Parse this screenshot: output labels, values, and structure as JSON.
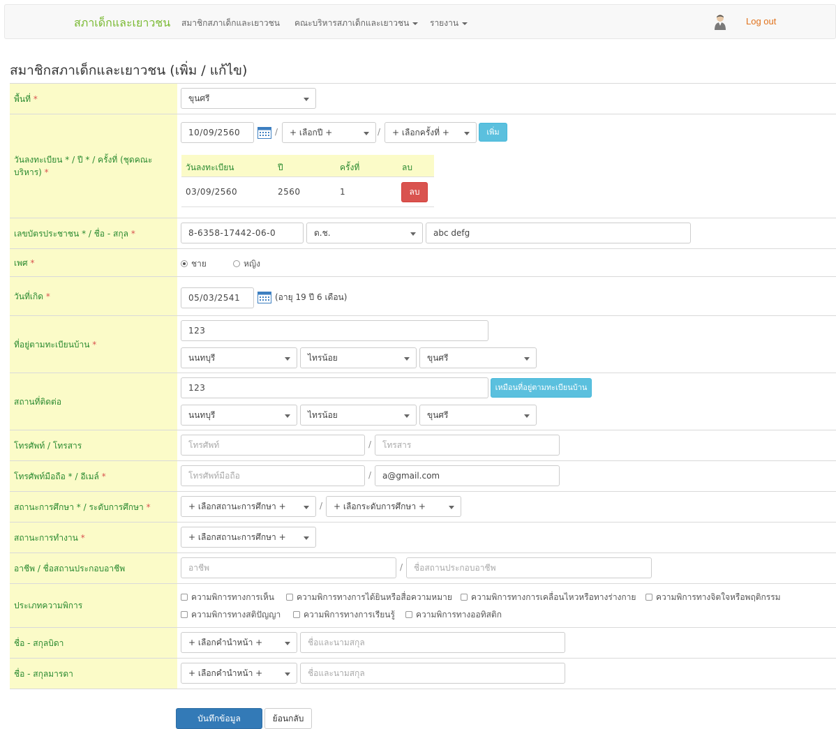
{
  "nav": {
    "brand": "สภาเด็กและเยาวชน",
    "members": "สมาชิกสภาเด็กและเยาวชน",
    "committee": "คณะบริหารสภาเด็กและเยาวชน",
    "report": "รายงาน",
    "logout": "Log out"
  },
  "page_title": "สมาชิกสภาเด็กและเยาวชน (เพิ่ม / แก้ไข)",
  "req_mark": "*",
  "slash": "/",
  "area": {
    "label": "พื้นที่",
    "value": "ขุนศรี"
  },
  "registration": {
    "label": "วันลงทะเบียน * / ปี * / ครั้งที่ (ชุดคณะบริหาร)",
    "date": "10/09/2560",
    "year_placeholder": "+ เลือกปี +",
    "round_placeholder": "+ เลือกครั้งที่ +",
    "add_button": "เพิ่ม",
    "table_headers": [
      "วันลงทะเบียน",
      "ปี",
      "ครั้งที่",
      "ลบ"
    ],
    "rows": [
      {
        "date": "03/09/2560",
        "year": "2560",
        "round": "1",
        "delete": "ลบ"
      }
    ]
  },
  "id_name": {
    "label": "เลขบัตรประชาชน * / ชื่อ - สกุล",
    "id_number": "8-6358-17442-06-0",
    "title": "ด.ช.",
    "full_name": "abc defg"
  },
  "gender": {
    "label": "เพศ",
    "male": "ชาย",
    "female": "หญิง",
    "selected": "male"
  },
  "birthdate": {
    "label": "วันที่เกิด",
    "value": "05/03/2541",
    "age_text": "(อายุ 19 ปี 6 เดือน)"
  },
  "home_address": {
    "label": "ที่อยู่ตามทะเบียนบ้าน",
    "address": "123",
    "province": "นนทบุรี",
    "district": "ไทรน้อย",
    "subdistrict": "ขุนศรี"
  },
  "contact_address": {
    "label": "สถานที่ติดต่อ",
    "address": "123",
    "same_button": "เหมือนที่อยู่ตามทะเบียนบ้าน",
    "province": "นนทบุรี",
    "district": "ไทรน้อย",
    "subdistrict": "ขุนศรี"
  },
  "phone_fax": {
    "label": "โทรศัพท์ / โทรสาร",
    "phone_placeholder": "โทรศัพท์",
    "fax_placeholder": "โทรสาร"
  },
  "mobile_email": {
    "label": "โทรศัพท์มือถือ * / อีเมล์",
    "mobile_placeholder": "โทรศัพท์มือถือ",
    "email": "a@gmail.com"
  },
  "education": {
    "label": "สถานะการศึกษา * / ระดับการศึกษา",
    "status_placeholder": "+ เลือกสถานะการศึกษา +",
    "level_placeholder": "+ เลือกระดับการศึกษา +"
  },
  "work_status": {
    "label": "สถานะการทำงาน",
    "placeholder": "+ เลือกสถานะการศึกษา +"
  },
  "occupation": {
    "label": "อาชีพ / ชื่อสถานประกอบอาชีพ",
    "occupation_placeholder": "อาชีพ",
    "workplace_placeholder": "ชื่อสถานประกอบอาชีพ"
  },
  "disability": {
    "label": "ประเภทความพิการ",
    "options": [
      "ความพิการทางการเห็น",
      "ความพิการทางการได้ยินหรือสื่อความหมาย",
      "ความพิการทางการเคลื่อนไหวหรือทางร่างกาย",
      "ความพิการทางจิตใจหรือพฤติกรรม",
      "ความพิการทางสติปัญญา",
      "ความพิการทางการเรียนรู้",
      "ความพิการทางออทิสติก"
    ]
  },
  "father": {
    "label": "ชื่อ - สกุลบิดา",
    "prefix_placeholder": "+ เลือกคำนำหน้า +",
    "name_placeholder": "ชื่อและนามสกุล"
  },
  "mother": {
    "label": "ชื่อ - สกุลมารดา",
    "prefix_placeholder": "+ เลือกคำนำหน้า +",
    "name_placeholder": "ชื่อและนามสกุล"
  },
  "actions": {
    "save": "บันทึกข้อมูล",
    "back": "ย้อนกลับ"
  }
}
